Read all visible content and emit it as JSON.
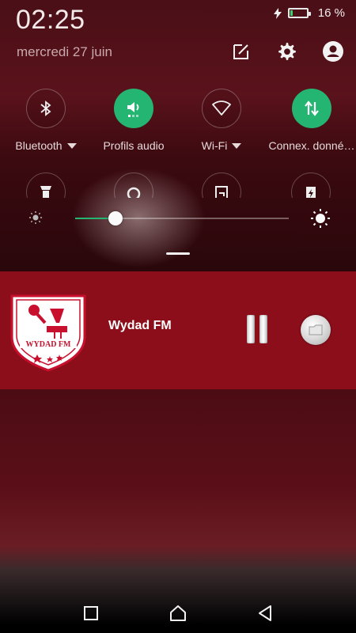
{
  "status": {
    "time": "02:25",
    "date": "mercredi 27 juin",
    "battery_percent_text": "16 %",
    "battery_level": 0.16,
    "charging": true
  },
  "header_icons": [
    "edit-icon",
    "settings-gear-icon",
    "account-icon"
  ],
  "quick_tiles": [
    {
      "label": "Bluetooth",
      "icon": "bluetooth-icon",
      "active": false,
      "has_dropdown": true
    },
    {
      "label": "Profils audio",
      "icon": "sound-profile-icon",
      "active": true,
      "has_dropdown": false
    },
    {
      "label": "Wi-Fi",
      "icon": "wifi-icon",
      "active": false,
      "has_dropdown": true
    },
    {
      "label": "Connex. donné…",
      "icon": "mobile-data-icon",
      "active": true,
      "has_dropdown": false
    }
  ],
  "quick_tiles_row2": [
    "flashlight-icon",
    "rotation-icon",
    "screen-cast-icon",
    "battery-saver-icon"
  ],
  "brightness": {
    "level": 0.19
  },
  "media_notification": {
    "station": "Wydad FM",
    "logo_text": "WYDAD FM",
    "colors": {
      "background": "#8b0e1a",
      "accent": "#25b572"
    }
  },
  "navbar": [
    "recents-square-icon",
    "home-icon",
    "back-icon"
  ]
}
